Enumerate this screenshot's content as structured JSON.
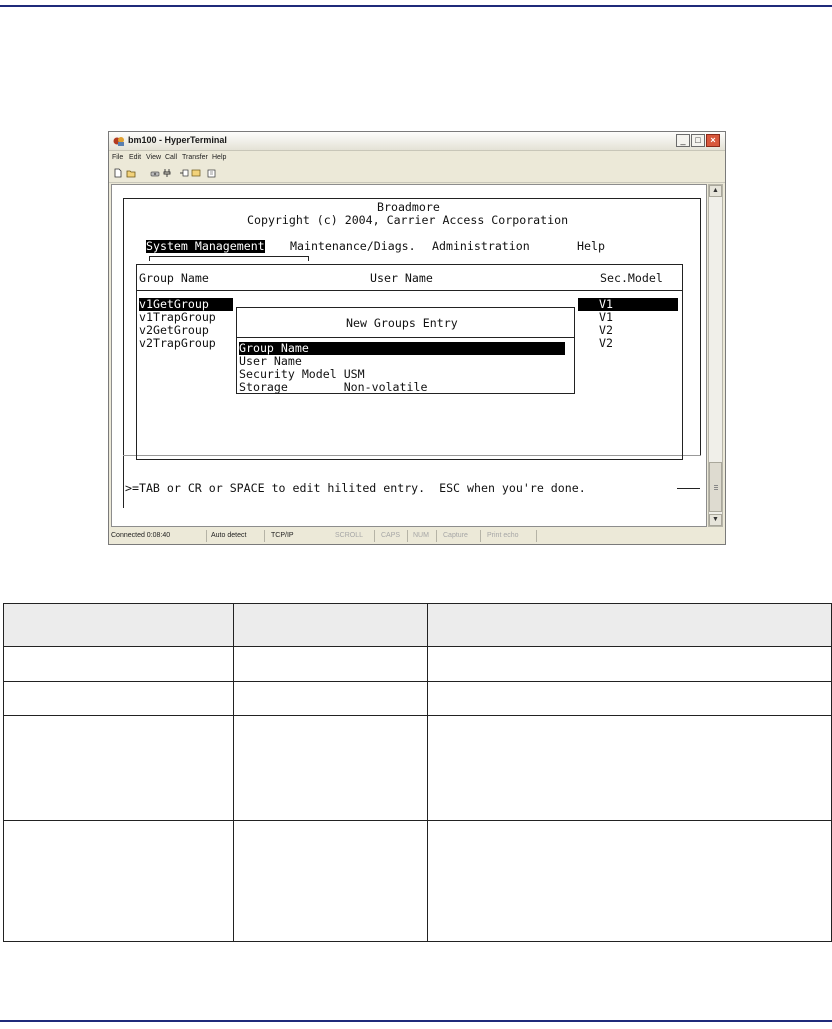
{
  "window": {
    "title": "bm100 - HyperTerminal",
    "menu": [
      "File",
      "Edit",
      "View",
      "Call",
      "Transfer",
      "Help"
    ]
  },
  "terminal": {
    "product": "Broadmore",
    "copyright": "Copyright (c) 2004, Carrier Access Corporation",
    "menus": [
      "System Management",
      "Maintenance/Diags.",
      "Administration",
      "Help"
    ],
    "columns": [
      "Group Name",
      "User Name",
      "Sec.Model"
    ],
    "groups": [
      {
        "name": "v1GetGroup",
        "model": "V1"
      },
      {
        "name": "v1TrapGroup",
        "model": "V1"
      },
      {
        "name": "v2GetGroup",
        "model": "V2"
      },
      {
        "name": "v2TrapGroup",
        "model": "V2"
      }
    ],
    "dialog": {
      "title": "New Groups Entry",
      "fields": [
        "Group Name",
        "User Name",
        "Security Model USM",
        "Storage        Non-volatile"
      ]
    },
    "prompt": ">=TAB or CR or SPACE to edit hilited entry.  ESC when you're done."
  },
  "status": {
    "connected": "Connected 0:08:40",
    "detect": "Auto detect",
    "protocol": "TCP/IP",
    "indicators": [
      "SCROLL",
      "CAPS",
      "NUM",
      "Capture",
      "Print echo"
    ]
  },
  "colors": {
    "rule": "#1f2a7a",
    "header_fill": "#ececec",
    "close_button": "#d8583c"
  },
  "icons": [
    "app-icon",
    "new-icon",
    "open-icon",
    "phone-icon",
    "disconnect-icon",
    "send-icon",
    "receive-icon",
    "properties-icon"
  ]
}
